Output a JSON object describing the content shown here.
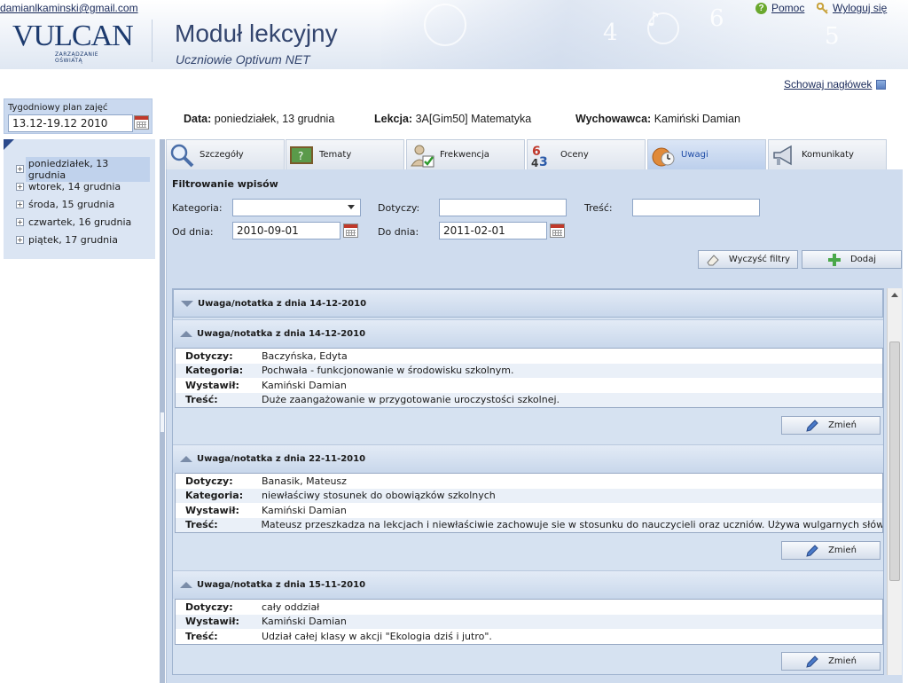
{
  "header": {
    "user_email": "damianlkaminski@gmail.com",
    "logo_text": "VULCAN",
    "logo_tagline": "ZARZĄDZANIE OŚWIATĄ",
    "module_title": "Moduł lekcyjny",
    "module_subtitle": "Uczniowie Optivum NET",
    "help_label": "Pomoc",
    "logout_label": "Wyloguj się",
    "hide_header_label": "Schowaj nagłówek"
  },
  "sidebar": {
    "week_label": "Tygodniowy plan zajęć",
    "week_value": "13.12-19.12 2010",
    "days": [
      {
        "label": "poniedziałek, 13 grudnia",
        "active": true
      },
      {
        "label": "wtorek, 14 grudnia",
        "active": false
      },
      {
        "label": "środa, 15 grudnia",
        "active": false
      },
      {
        "label": "czwartek, 16 grudnia",
        "active": false
      },
      {
        "label": "piątek, 17 grudnia",
        "active": false
      }
    ]
  },
  "lesson": {
    "date_label": "Data:",
    "date_value": "poniedziałek, 13 grudnia",
    "lesson_label": "Lekcja:",
    "lesson_value": "3A[Gim50]  Matematyka",
    "tutor_label": "Wychowawca:",
    "tutor_value": "Kamiński Damian"
  },
  "tabs": [
    {
      "label": "Szczegóły",
      "icon": "magnifier-icon",
      "active": false
    },
    {
      "label": "Tematy",
      "icon": "board-icon",
      "active": false
    },
    {
      "label": "Frekwencja",
      "icon": "person-check-icon",
      "active": false
    },
    {
      "label": "Oceny",
      "icon": "grades-icon",
      "active": false
    },
    {
      "label": "Uwagi",
      "icon": "notes-icon",
      "active": true
    },
    {
      "label": "Komunikaty",
      "icon": "megaphone-icon",
      "active": false
    }
  ],
  "filters": {
    "title": "Filtrowanie wpisów",
    "category_label": "Kategoria:",
    "category_value": "",
    "concerns_label": "Dotyczy:",
    "concerns_value": "",
    "content_label": "Treść:",
    "content_value": "",
    "from_label": "Od dnia:",
    "from_value": "2010-09-01",
    "to_label": "Do dnia:",
    "to_value": "2011-02-01",
    "clear_label": "Wyczyść filtry",
    "add_label": "Dodaj"
  },
  "notes": {
    "edit_label": "Zmień",
    "collapsed_header": "Uwaga/notatka z dnia 14-12-2010",
    "items": [
      {
        "header": "Uwaga/notatka z dnia 14-12-2010",
        "rows": [
          {
            "k": "Dotyczy:",
            "v": "Baczyńska, Edyta"
          },
          {
            "k": "Kategoria:",
            "v": "Pochwała - funkcjonowanie w środowisku szkolnym."
          },
          {
            "k": "Wystawił:",
            "v": "Kamiński Damian"
          },
          {
            "k": "Treść:",
            "v": "Duże zaangażowanie w przygotowanie uroczystości szkolnej."
          }
        ]
      },
      {
        "header": "Uwaga/notatka z dnia 22-11-2010",
        "rows": [
          {
            "k": "Dotyczy:",
            "v": "Banasik, Mateusz"
          },
          {
            "k": "Kategoria:",
            "v": "niewłaściwy stosunek do obowiązków szkolnych"
          },
          {
            "k": "Wystawił:",
            "v": "Kamiński Damian"
          },
          {
            "k": "Treść:",
            "v": "Mateusz przeszkadza na lekcjach i niewłaściwie zachowuje sie w stosunku do nauczycieli oraz uczniów. Używa wulgarnych słów."
          }
        ]
      },
      {
        "header": "Uwaga/notatka z dnia 15-11-2010",
        "rows": [
          {
            "k": "Dotyczy:",
            "v": "cały oddział"
          },
          {
            "k": "Wystawił:",
            "v": "Kamiński Damian"
          },
          {
            "k": "Treść:",
            "v": "Udział całej klasy w akcji \"Ekologia dziś i jutro\"."
          }
        ]
      }
    ]
  },
  "colors": {
    "brand": "#1c3a6e",
    "active_tab_text": "#1f4ca6",
    "panel_bg": "#cfdcee"
  }
}
